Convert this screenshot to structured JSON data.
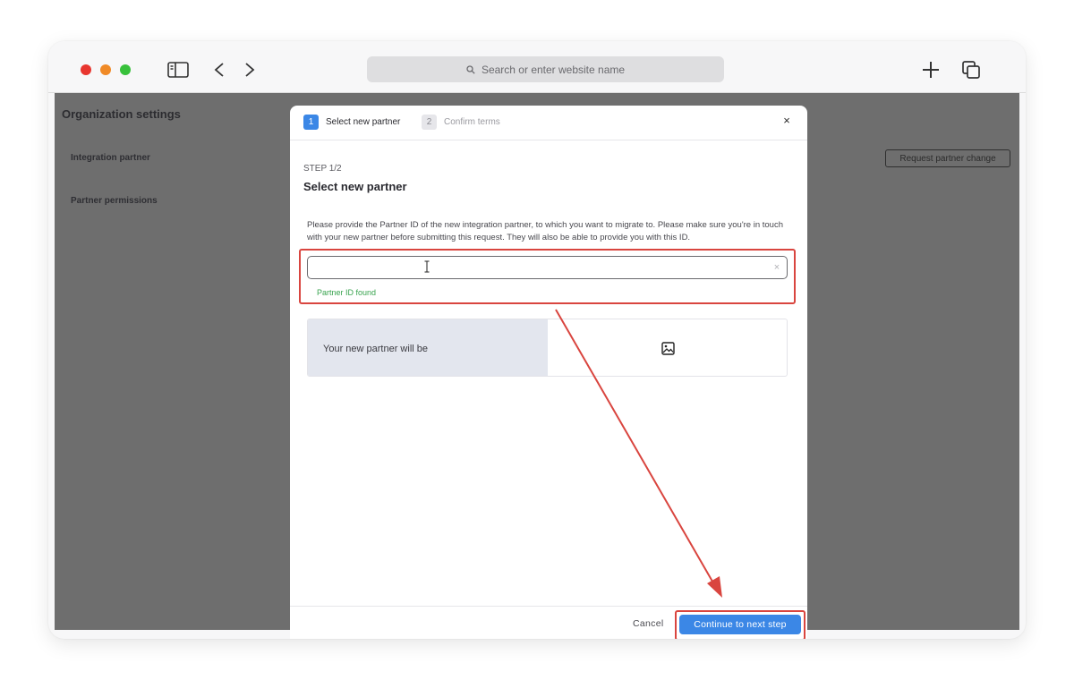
{
  "browser": {
    "address_placeholder": "Search or enter website name",
    "icons": [
      "sidebar-icon",
      "back-icon",
      "forward-icon",
      "search-icon",
      "new-tab-icon",
      "tabs-overview-icon"
    ]
  },
  "page": {
    "title": "Organization settings",
    "sidebar": [
      {
        "label": "Integration partner"
      },
      {
        "label": "Partner permissions"
      }
    ],
    "request_button": "Request partner change"
  },
  "modal": {
    "steps": [
      {
        "number": "1",
        "label": "Select new partner",
        "active": true
      },
      {
        "number": "2",
        "label": "Confirm terms",
        "active": false
      }
    ],
    "close": "×",
    "step_caption": "STEP 1/2",
    "title": "Select new partner",
    "description": "Please provide the Partner ID of the new integration partner, to which you want to migrate to. Please make sure you're in touch with your new partner before submitting this request. They will also be able to provide you with this ID.",
    "input_value": "",
    "clear": "×",
    "status_text": "Partner ID found",
    "partner_label": "Your new partner will be",
    "footer": {
      "cancel": "Cancel",
      "continue": "Continue to next step"
    }
  },
  "colors": {
    "accent": "#3b87e6",
    "highlight": "#d9453f",
    "success": "#38a34e",
    "overlay": "#6e6e6e"
  }
}
